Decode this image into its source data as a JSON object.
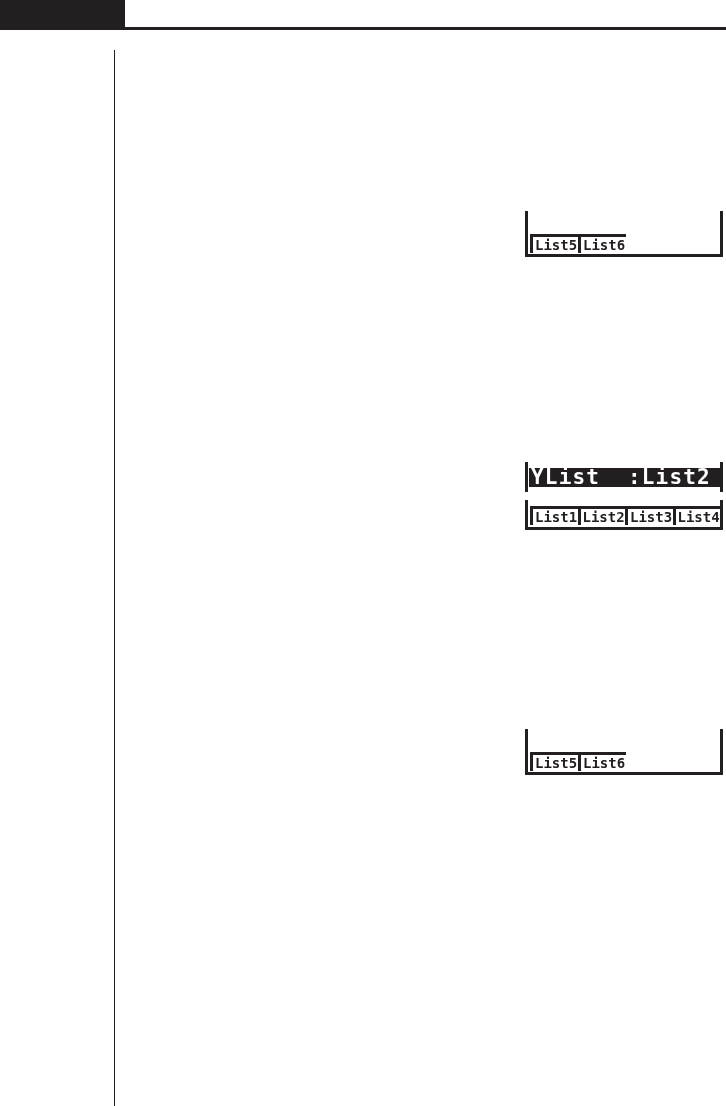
{
  "screens": [
    {
      "function_keys": [
        "List5",
        "List6"
      ]
    },
    {
      "setting": {
        "text": "YList  :List2",
        "selected": true
      },
      "function_keys": [
        "List1",
        "List2",
        "List3",
        "List4"
      ]
    },
    {
      "function_keys": [
        "List5",
        "List6"
      ]
    }
  ]
}
